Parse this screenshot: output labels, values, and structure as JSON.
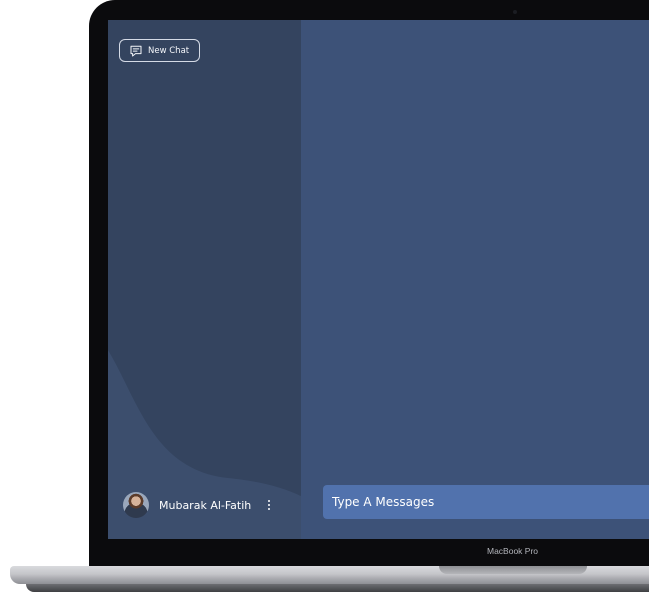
{
  "sidebar": {
    "new_chat_label": "New Chat",
    "user_name": "Mubarak Al-Fatih",
    "icons": {
      "new_chat": "chat-plus-icon",
      "more": "more-vertical-icon"
    }
  },
  "main": {
    "input_placeholder": "Type A Messages"
  },
  "device": {
    "label": "MacBook Pro"
  },
  "colors": {
    "sidebar_bg": "#34445f",
    "main_bg": "#3d5278",
    "input_bg": "#5172ad",
    "bezel": "#0b0b0d"
  }
}
